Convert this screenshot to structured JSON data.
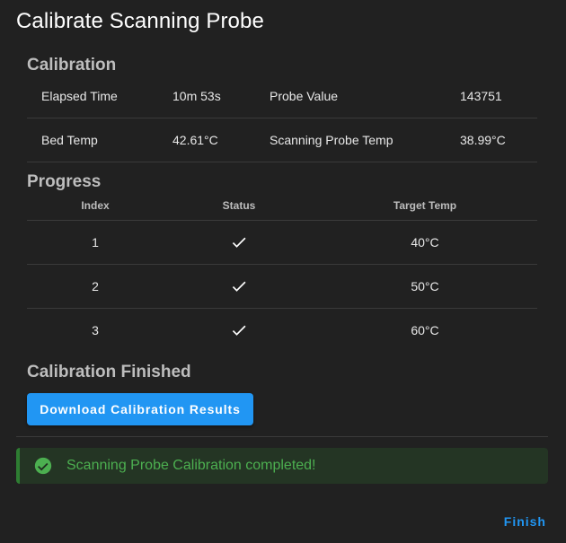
{
  "dialog": {
    "title": "Calibrate Scanning Probe"
  },
  "calibration": {
    "heading": "Calibration",
    "rows": [
      {
        "label1": "Elapsed Time",
        "value1": "10m 53s",
        "label2": "Probe Value",
        "value2": "143751"
      },
      {
        "label1": "Bed Temp",
        "value1": "42.61°C",
        "label2": "Scanning Probe Temp",
        "value2": "38.99°C"
      }
    ]
  },
  "progress": {
    "heading": "Progress",
    "columns": {
      "index": "Index",
      "status": "Status",
      "target": "Target Temp"
    },
    "rows": [
      {
        "index": "1",
        "status_icon": "check-icon",
        "target": "40°C"
      },
      {
        "index": "2",
        "status_icon": "check-icon",
        "target": "50°C"
      },
      {
        "index": "3",
        "status_icon": "check-icon",
        "target": "60°C"
      }
    ]
  },
  "finished": {
    "heading": "Calibration Finished",
    "download_label": "Download Calibration Results"
  },
  "alert": {
    "icon": "check-circle-icon",
    "text": "Scanning Probe Calibration completed!",
    "color": "#4caf50"
  },
  "actions": {
    "finish_label": "Finish"
  },
  "colors": {
    "accent": "#2196f3",
    "success": "#4caf50",
    "background": "#212121"
  }
}
